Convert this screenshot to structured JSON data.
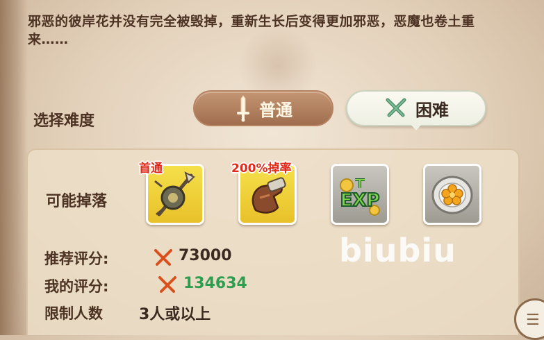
{
  "description": "邪恶的彼岸花并没有完全被毁掉，重新生长后变得更加邪恶，恶魔也卷土重来……",
  "difficulty": {
    "label": "选择难度",
    "normal_label": "普通",
    "hard_label": "困难",
    "selected": "困难"
  },
  "drops": {
    "label": "可能掉落",
    "items": [
      {
        "icon": "staff-weapon-icon",
        "tag": "首通",
        "frame": "gold"
      },
      {
        "icon": "glove-icon",
        "tag": "200%掉率",
        "frame": "gold"
      },
      {
        "icon": "exp-icon",
        "tag": "",
        "frame": "grey"
      },
      {
        "icon": "gold-coin-plate-icon",
        "tag": "",
        "frame": "grey"
      }
    ]
  },
  "stats": {
    "recommended_label": "推荐评分:",
    "recommended_value": "73000",
    "my_label": "我的评分:",
    "my_value": "134634",
    "limit_label": "限制人数",
    "limit_value": "3人或以上"
  },
  "watermark": "biubiu",
  "colors": {
    "text_brown": "#4b3222",
    "score_green": "#2f9d4f",
    "tag_red": "#e02a1a",
    "normal_button": "#a06e4f",
    "hard_button": "#eef0e4"
  }
}
